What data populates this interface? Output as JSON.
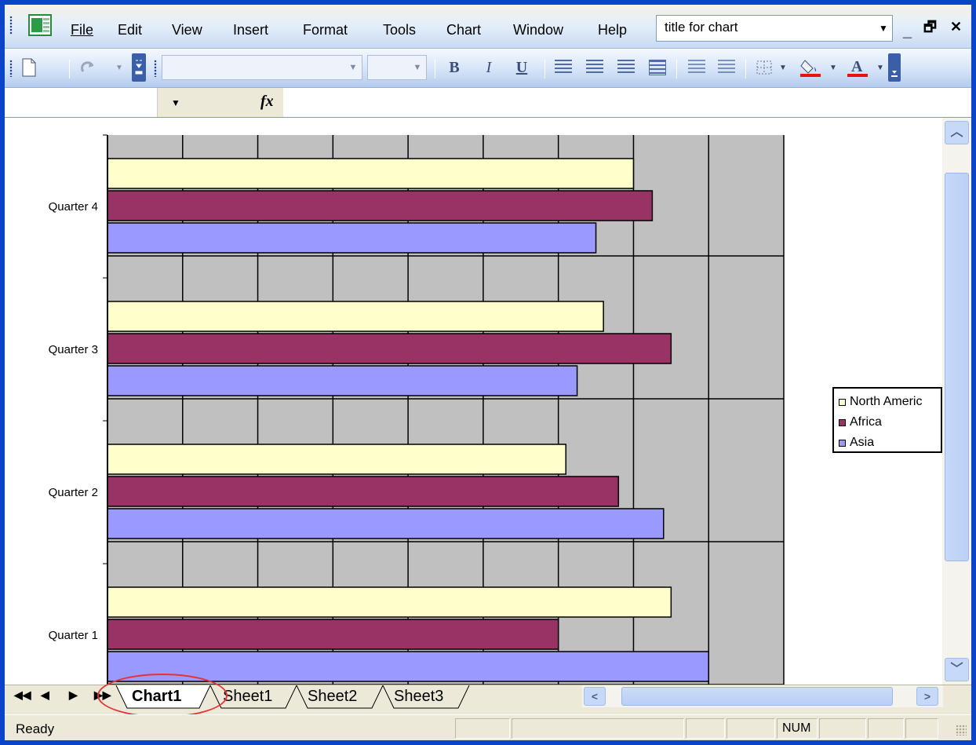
{
  "menu": {
    "items": [
      "File",
      "Edit",
      "View",
      "Insert",
      "Format",
      "Tools",
      "Chart",
      "Window",
      "Help"
    ],
    "title_box_value": "title for chart"
  },
  "window_controls": {
    "minimize": "_",
    "restore": "🗗",
    "close": "✕"
  },
  "toolbar": {
    "bold": "B",
    "italic": "I",
    "underline": "U",
    "font_name": "",
    "font_size": ""
  },
  "formula_bar": {
    "fx": "fx",
    "name_box": ""
  },
  "chart_data": {
    "type": "bar",
    "orientation": "horizontal",
    "categories": [
      "Quarter 1",
      "Quarter 2",
      "Quarter 3",
      "Quarter 4"
    ],
    "series": [
      {
        "name": "North America",
        "color": "#FFFFCC",
        "values": [
          75,
          61,
          66,
          70
        ]
      },
      {
        "name": "Africa",
        "color": "#993366",
        "values": [
          60,
          68,
          75,
          72.5
        ]
      },
      {
        "name": "Asia",
        "color": "#9999FF",
        "values": [
          80,
          74,
          62.5,
          65
        ]
      }
    ],
    "xlim": [
      0,
      90
    ],
    "gridlines": true,
    "plot_background": "#C0C0C0",
    "legend_position": "right",
    "visible_categories": [
      "Quarter 4",
      "Quarter 3",
      "Quarter 2",
      "Quarter 1"
    ]
  },
  "legend": {
    "items": [
      {
        "label": "North Americ",
        "color": "#FFFFCC"
      },
      {
        "label": "Africa",
        "color": "#993366"
      },
      {
        "label": "Asia",
        "color": "#9999FF"
      }
    ]
  },
  "tabs": {
    "items": [
      "Chart1",
      "Sheet1",
      "Sheet2",
      "Sheet3"
    ],
    "active": "Chart1"
  },
  "status": {
    "text": "Ready",
    "num": "NUM"
  }
}
